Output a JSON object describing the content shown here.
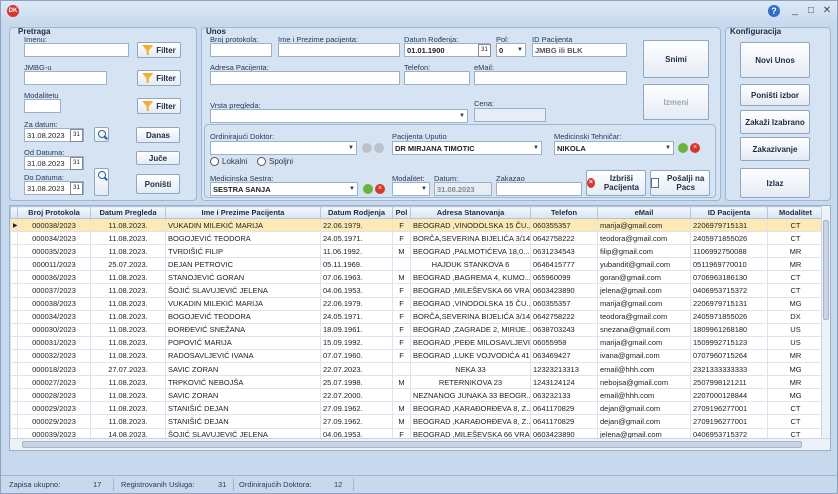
{
  "window": {
    "icon": "DK",
    "help": "?",
    "minimize": "_",
    "maximize": "□",
    "close": "✕"
  },
  "pretraga": {
    "title": "Pretraga",
    "imenu_label": "Imenu:",
    "jmbg_label": "JMBG-u",
    "modalitet_label": "Modalitetu",
    "filter_label": "Filter",
    "za_datum_label": "Za datum:",
    "za_datum": "31.08.2023",
    "od_label": "Od Datuma:",
    "od_datum": "31.08.2023",
    "do_label": "Do Datuma:",
    "do_datum": "31.08.2023",
    "danas": "Danas",
    "juce": "Juče",
    "ponisti": "Poništi",
    "cal": "31"
  },
  "unos": {
    "title": "Unos",
    "broj_label": "Broj protokola:",
    "ime_label": "Ime i Prezime pacijenta:",
    "datum_rodj_label": "Datum Rođenja:",
    "datum_rodj": "01.01.1900",
    "pol_label": "Pol:",
    "pol": "0",
    "id_label": "ID Pacijenta",
    "id_value": "JMBG ili BLK",
    "adresa_label": "Adresa Pacijenta:",
    "telefon_label": "Telefon:",
    "email_label": "eMail:",
    "vrsta_label": "Vrsta pregleda:",
    "cena_label": "Cena:",
    "snimi": "Snimi",
    "izmeni": "Izmeni",
    "doktor_label": "Ordinirajući Doktor:",
    "uputio_label": "Pacijenta Uputio",
    "uputio": "DR MIRJANA TIMOTIC",
    "tehnicar_label": "Medicinski Tehničar:",
    "tehnicar": "NIKOLA",
    "lokalni": "Lokalni",
    "spoljni": "Spoljni",
    "sestra_label": "Medicinska Sestra:",
    "sestra": "SESTRA SANJA",
    "modalitet_label": "Modalitet:",
    "datum_label": "Datum:",
    "datum": "31.08.2023",
    "zakazao_label": "Zakazao",
    "izbrisi": "Izbriši Pacijenta",
    "posalji": "Pošalji na Pacs"
  },
  "konfig": {
    "title": "Konfiguracija",
    "novi_unos": "Novi Unos",
    "ponisti_izbor": "Poništi izbor",
    "zakazi": "Zakaži Izabrano",
    "zakazivanje": "Zakazivanje",
    "izlaz": "Izlaz"
  },
  "table": {
    "columns": [
      "Broj Protokola",
      "Datum Pregleda",
      "Ime i Prezime Pacijenta",
      "Datum Rodjenja",
      "Pol",
      "Adresa Stanovanja",
      "Telefon",
      "eMail",
      "ID Pacijenta",
      "Modalitet"
    ],
    "rows": [
      [
        "000038/2023",
        "11.08.2023.",
        "VUKADIN MILEKIĆ MARIJA",
        "22.06.1979.",
        "F",
        "BEOGRAD ,VINODOLSKA 15 ČU...",
        "060355357",
        "marija@gmail.com",
        "2206979715131",
        "CT"
      ],
      [
        "000034/2023",
        "11.08.2023.",
        "BOGOJEVIĆ TEODORA",
        "24.05.1971.",
        "F",
        "BORČA,SEVERINA BIJELIĆA 3/14,",
        "0642758222",
        "teodora@gmail.com",
        "2405971855026",
        "CT"
      ],
      [
        "000035/2023",
        "11.08.2023.",
        "TVRDIŠIĆ FILIP",
        "11.06.1992.",
        "M",
        "BEOGRAD ,PALMOTIĆEVA 18,0...",
        "0631234543",
        "filip@gmail.com",
        "1106992750088",
        "MR"
      ],
      [
        "000011/2023",
        "25.07.2023.",
        "DEJAN PETROVIC",
        "05.11.1969.",
        "",
        "HAJDUK STANKOVA 6",
        "0646415777",
        "yubandit@gmail.com",
        "0511969770010",
        "MR"
      ],
      [
        "000036/2023",
        "11.08.2023.",
        "STANOJEVIĆ GORAN",
        "07.06.1963.",
        "M",
        "BEOGRAD ,BAGREMA 4, KUMO...",
        "065960099",
        "goran@gmail.com",
        "0706963186130",
        "CT"
      ],
      [
        "000037/2023",
        "11.08.2023.",
        "ŠOJIĆ SLAVUJEVIĆ JELENA",
        "04.06.1953.",
        "F",
        "BEOGRAD ,MILEŠEVSKA 66 VRA...",
        "0603423890",
        "jelena@gmail.com",
        "0406953715372",
        "CT"
      ],
      [
        "000038/2023",
        "11.08.2023.",
        "VUKADIN MILEKIĆ MARIJA",
        "22.06.1979.",
        "F",
        "BEOGRAD ,VINODOLSKA 15 ČU...",
        "060355357",
        "marija@gmail.com",
        "2206979715131",
        "MG"
      ],
      [
        "000034/2023",
        "11.08.2023.",
        "BOGOJEVIĆ TEODORA",
        "24.05.1971.",
        "F",
        "BORČA,SEVERINA BIJELIĆA 3/14,",
        "0642758222",
        "teodora@gmail.com",
        "2405971855026",
        "DX"
      ],
      [
        "000030/2023",
        "11.08.2023.",
        "ĐORĐEVIĆ SNEŽANA",
        "18.09.1961.",
        "F",
        "BEOGRAD ,ZAGRADE 2, MIRIJE...",
        "0638703243",
        "snezana@gmail.com",
        "1809961268180",
        "US"
      ],
      [
        "000031/2023",
        "11.08.2023.",
        "POPOVIĆ MARIJA",
        "15.09.1992.",
        "F",
        "BEOGRAD ,PEĐE MILOSAVLJEVI...",
        "06055958",
        "marija@gmail.com",
        "1509992715123",
        "US"
      ],
      [
        "000032/2023",
        "11.08.2023.",
        "RADOSAVLJEVIĆ IVANA",
        "07.07.1960.",
        "F",
        "BEOGRAD ,LUKE VOJVODIĆA 41",
        "063469427",
        "ivana@gmail.com",
        "0707960715264",
        "MR"
      ],
      [
        "000018/2023",
        "27.07.2023.",
        "SAVIC ZORAN",
        "22.07.2023.",
        "",
        "NEKA 33",
        "12323213313",
        "email@hhh.com",
        "2321333333333",
        "MG"
      ],
      [
        "000027/2023",
        "11.08.2023.",
        "TRPKOVIĆ NEBOJŠA",
        "25.07.1998.",
        "M",
        "RETERNIKOVA 23",
        "1243124124",
        "nebojsa@gmail.com",
        "2507998121211",
        "MR"
      ],
      [
        "000028/2023",
        "11.08.2023.",
        "SAVIC ZORAN",
        "22.07.2000.",
        "",
        "NEZNANOG JUNAKA 33 BEOGR...",
        "063232133",
        "email@hhh.com",
        "2207000128844",
        "MG"
      ],
      [
        "000029/2023",
        "11.08.2023.",
        "STANIŠIĆ DEJAN",
        "27.09.1962.",
        "M",
        "BEOGRAD ,KARAĐORĐEVA 8, Z...",
        "0641170829",
        "dejan@gmail.com",
        "2709196277001",
        "CT"
      ],
      [
        "000029/2023",
        "11.08.2023.",
        "STANIŠIĆ DEJAN",
        "27.09.1962.",
        "M",
        "BEOGRAD ,KARAĐORĐEVA 8, Z...",
        "0641170829",
        "dejan@gmail.com",
        "2709196277001",
        "CT"
      ],
      [
        "000039/2023",
        "14.08.2023.",
        "ŠOJIĆ SLAVUJEVIĆ JELENA",
        "04.06.1953.",
        "F",
        "BEOGRAD ,MILEŠEVSKA 66 VRA...",
        "0603423890",
        "jelena@gmail.com",
        "0406953715372",
        "CT"
      ]
    ]
  },
  "status": {
    "zapisa_label": "Zapisa ukupno:",
    "zapisa": "17",
    "usluga_label": "Registrovanih Usluga:",
    "usluga": "31",
    "doktora_label": "Ordinirajućih Doktora:",
    "doktora": "12"
  }
}
